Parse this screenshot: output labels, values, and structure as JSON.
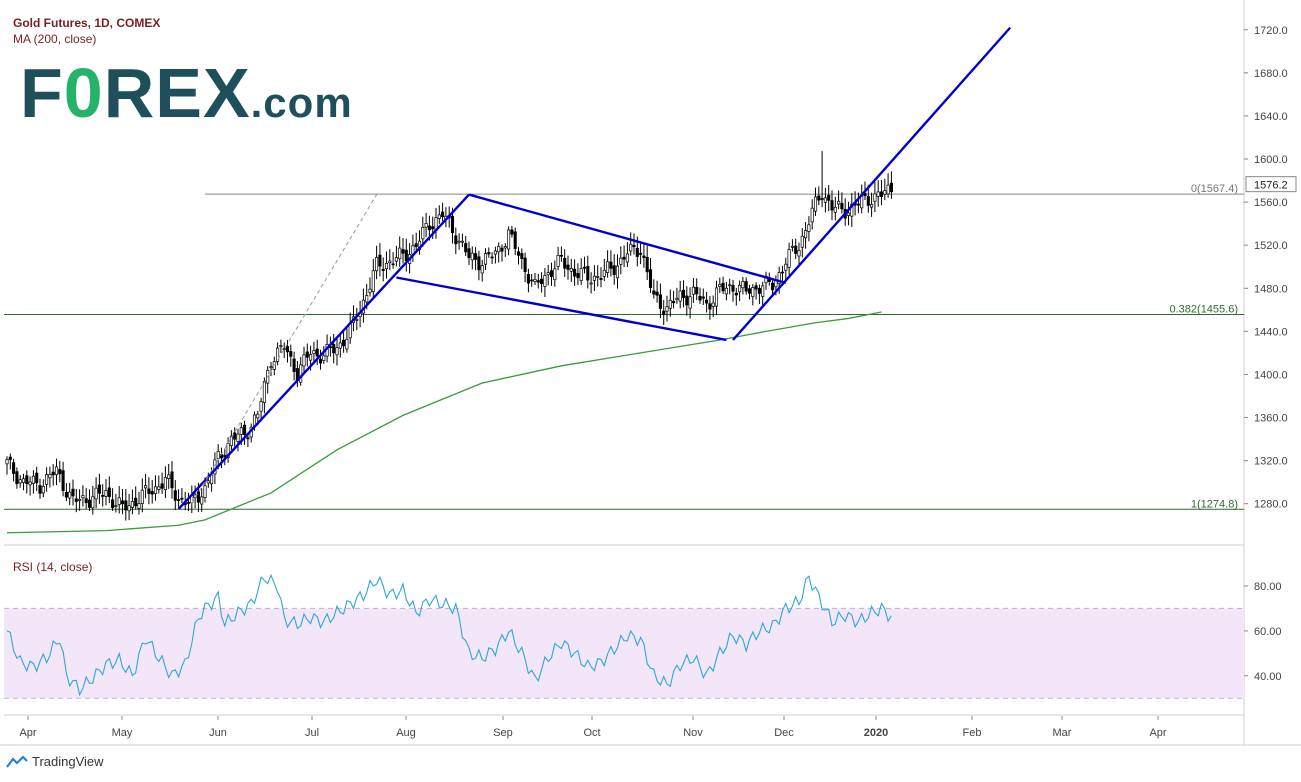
{
  "header": {
    "title": "Gold Futures, 1D, COMEX",
    "ma_label": "MA (200, close)",
    "rsi_label": "RSI (14, close)"
  },
  "logo": {
    "text_main": "FOREX",
    "text_suffix": ".com",
    "accent_color": "#25b36a",
    "brand_color": "#1f4f5a"
  },
  "footer": {
    "brand": "TradingView",
    "icon": "tradingview-logo-icon"
  },
  "colors": {
    "up": "#ffffff",
    "down": "#000000",
    "wick": "#000000",
    "trendline": "#0000cc",
    "ma": "#3b9b3b",
    "rsi": "#2ea6d6",
    "rsi_band": "#f4e6f9",
    "fib": "#2f6b2f",
    "top_line": "#888888"
  },
  "chart_data": [
    {
      "type": "candlestick",
      "title": "Gold Futures, 1D, COMEX",
      "x_ticks": [
        "Apr",
        "May",
        "Jun",
        "Jul",
        "Aug",
        "Sep",
        "Oct",
        "Nov",
        "Dec",
        "2020",
        "Feb",
        "Mar",
        "Apr"
      ],
      "y_ticks": [
        1280.0,
        1320.0,
        1360.0,
        1400.0,
        1440.0,
        1480.0,
        1520.0,
        1560.0,
        1600.0,
        1640.0,
        1680.0,
        1720.0
      ],
      "ylim": [
        1250,
        1730
      ],
      "last_price": 1576.2,
      "series_anchor_close": [
        [
          0,
          1317
        ],
        [
          5,
          1300
        ],
        [
          10,
          1298
        ],
        [
          15,
          1310
        ],
        [
          20,
          1282
        ],
        [
          25,
          1285
        ],
        [
          30,
          1290
        ],
        [
          35,
          1275
        ],
        [
          40,
          1285
        ],
        [
          45,
          1295
        ],
        [
          48,
          1302
        ],
        [
          52,
          1285
        ],
        [
          56,
          1280
        ],
        [
          60,
          1295
        ],
        [
          64,
          1322
        ],
        [
          68,
          1340
        ],
        [
          72,
          1345
        ],
        [
          76,
          1362
        ],
        [
          80,
          1415
        ],
        [
          84,
          1425
        ],
        [
          88,
          1402
        ],
        [
          92,
          1420
        ],
        [
          96,
          1418
        ],
        [
          100,
          1425
        ],
        [
          104,
          1440
        ],
        [
          108,
          1468
        ],
        [
          112,
          1500
        ],
        [
          116,
          1505
        ],
        [
          120,
          1510
        ],
        [
          124,
          1520
        ],
        [
          128,
          1540
        ],
        [
          132,
          1548
        ],
        [
          136,
          1530
        ],
        [
          140,
          1508
        ],
        [
          144,
          1505
        ],
        [
          148,
          1512
        ],
        [
          152,
          1530
        ],
        [
          156,
          1505
        ],
        [
          160,
          1480
        ],
        [
          164,
          1495
        ],
        [
          168,
          1505
        ],
        [
          172,
          1495
        ],
        [
          176,
          1490
        ],
        [
          180,
          1492
        ],
        [
          184,
          1500
        ],
        [
          188,
          1512
        ],
        [
          192,
          1518
        ],
        [
          196,
          1470
        ],
        [
          200,
          1462
        ],
        [
          204,
          1472
        ],
        [
          208,
          1475
        ],
        [
          212,
          1465
        ],
        [
          216,
          1478
        ],
        [
          220,
          1482
        ],
        [
          224,
          1477
        ],
        [
          228,
          1482
        ],
        [
          232,
          1483
        ],
        [
          236,
          1505
        ],
        [
          240,
          1520
        ],
        [
          244,
          1550
        ],
        [
          247,
          1570
        ],
        [
          250,
          1555
        ],
        [
          253,
          1552
        ],
        [
          256,
          1555
        ],
        [
          259,
          1560
        ],
        [
          262,
          1565
        ],
        [
          265,
          1566
        ],
        [
          268,
          1573
        ]
      ],
      "ma200": [
        [
          0,
          1253
        ],
        [
          30,
          1255
        ],
        [
          52,
          1260
        ],
        [
          60,
          1265
        ],
        [
          80,
          1290
        ],
        [
          100,
          1330
        ],
        [
          120,
          1362
        ],
        [
          144,
          1392
        ],
        [
          168,
          1408
        ],
        [
          192,
          1420
        ],
        [
          216,
          1432
        ],
        [
          230,
          1440
        ],
        [
          245,
          1448
        ],
        [
          255,
          1452
        ],
        [
          265,
          1458
        ]
      ],
      "trendlines": [
        {
          "name": "rising-channel-lower",
          "from": [
            52,
            1275
          ],
          "to": [
            140,
            1567
          ]
        },
        {
          "name": "flag-upper",
          "from": [
            140,
            1567
          ],
          "to": [
            236,
            1485
          ]
        },
        {
          "name": "flag-lower",
          "from": [
            118,
            1490
          ],
          "to": [
            218,
            1432
          ]
        },
        {
          "name": "breakout-line",
          "from": [
            220,
            1432
          ],
          "to": [
            304,
            1722
          ]
        },
        {
          "name": "projection-dashed",
          "from": [
            56,
            1280
          ],
          "to": [
            112,
            1567
          ]
        }
      ],
      "levels": [
        {
          "label": "0(1567.4)",
          "value": 1567.4
        },
        {
          "label": "0.382(1455.6)",
          "value": 1455.6
        },
        {
          "label": "1(1274.8)",
          "value": 1274.8
        }
      ]
    },
    {
      "type": "line",
      "title": "RSI (14, close)",
      "y_ticks": [
        40.0,
        60.0,
        80.0
      ],
      "ylim": [
        27,
        88
      ],
      "band": [
        30,
        70
      ],
      "values": [
        [
          0,
          60
        ],
        [
          4,
          46
        ],
        [
          8,
          44
        ],
        [
          12,
          48
        ],
        [
          16,
          57
        ],
        [
          18,
          40
        ],
        [
          22,
          34
        ],
        [
          26,
          39
        ],
        [
          30,
          45
        ],
        [
          34,
          47
        ],
        [
          38,
          40
        ],
        [
          42,
          57
        ],
        [
          46,
          48
        ],
        [
          50,
          40
        ],
        [
          54,
          45
        ],
        [
          58,
          66
        ],
        [
          60,
          70
        ],
        [
          64,
          75
        ],
        [
          66,
          63
        ],
        [
          70,
          68
        ],
        [
          74,
          72
        ],
        [
          78,
          84
        ],
        [
          82,
          80
        ],
        [
          84,
          65
        ],
        [
          88,
          63
        ],
        [
          92,
          66
        ],
        [
          96,
          64
        ],
        [
          100,
          68
        ],
        [
          104,
          72
        ],
        [
          108,
          76
        ],
        [
          112,
          83
        ],
        [
          116,
          76
        ],
        [
          120,
          78
        ],
        [
          124,
          68
        ],
        [
          128,
          74
        ],
        [
          132,
          72
        ],
        [
          136,
          70
        ],
        [
          140,
          50
        ],
        [
          144,
          48
        ],
        [
          148,
          52
        ],
        [
          152,
          60
        ],
        [
          156,
          50
        ],
        [
          160,
          38
        ],
        [
          164,
          48
        ],
        [
          168,
          55
        ],
        [
          172,
          50
        ],
        [
          176,
          44
        ],
        [
          180,
          46
        ],
        [
          184,
          52
        ],
        [
          188,
          58
        ],
        [
          192,
          56
        ],
        [
          196,
          40
        ],
        [
          200,
          36
        ],
        [
          204,
          45
        ],
        [
          208,
          48
        ],
        [
          212,
          40
        ],
        [
          216,
          50
        ],
        [
          220,
          58
        ],
        [
          224,
          54
        ],
        [
          228,
          60
        ],
        [
          232,
          62
        ],
        [
          236,
          70
        ],
        [
          240,
          73
        ],
        [
          243,
          84
        ],
        [
          246,
          75
        ],
        [
          250,
          64
        ],
        [
          254,
          67
        ],
        [
          258,
          64
        ],
        [
          262,
          68
        ],
        [
          265,
          70
        ],
        [
          268,
          66
        ]
      ]
    }
  ]
}
